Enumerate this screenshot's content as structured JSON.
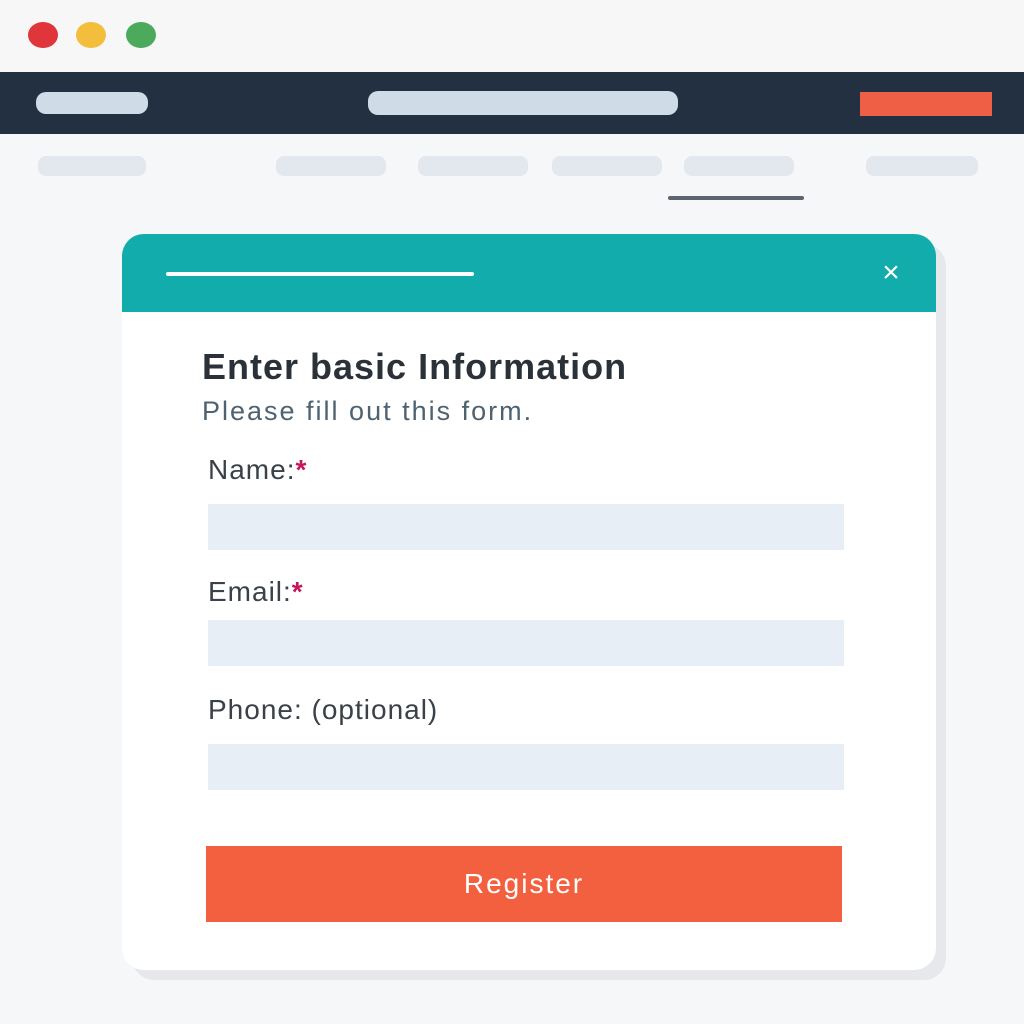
{
  "window": {
    "controls": [
      "close-dot",
      "minimize-dot",
      "maximize-dot"
    ]
  },
  "colors": {
    "navbar": "#223041",
    "accent_cta": "#ee5f45",
    "modal_header": "#13acac",
    "register_button": "#f3603f",
    "required_marker": "#c2185b",
    "input_background": "#e7eef5"
  },
  "modal": {
    "close_icon": "×",
    "title": "Enter basic Information",
    "subtitle": "Please fill out this form.",
    "fields": [
      {
        "label": "Name:",
        "required_marker": "*",
        "value": "",
        "placeholder": ""
      },
      {
        "label": "Email:",
        "required_marker": "*",
        "value": "",
        "placeholder": ""
      },
      {
        "label": "Phone: (optional)",
        "required_marker": "",
        "value": "",
        "placeholder": ""
      }
    ],
    "submit_label": "Register"
  }
}
